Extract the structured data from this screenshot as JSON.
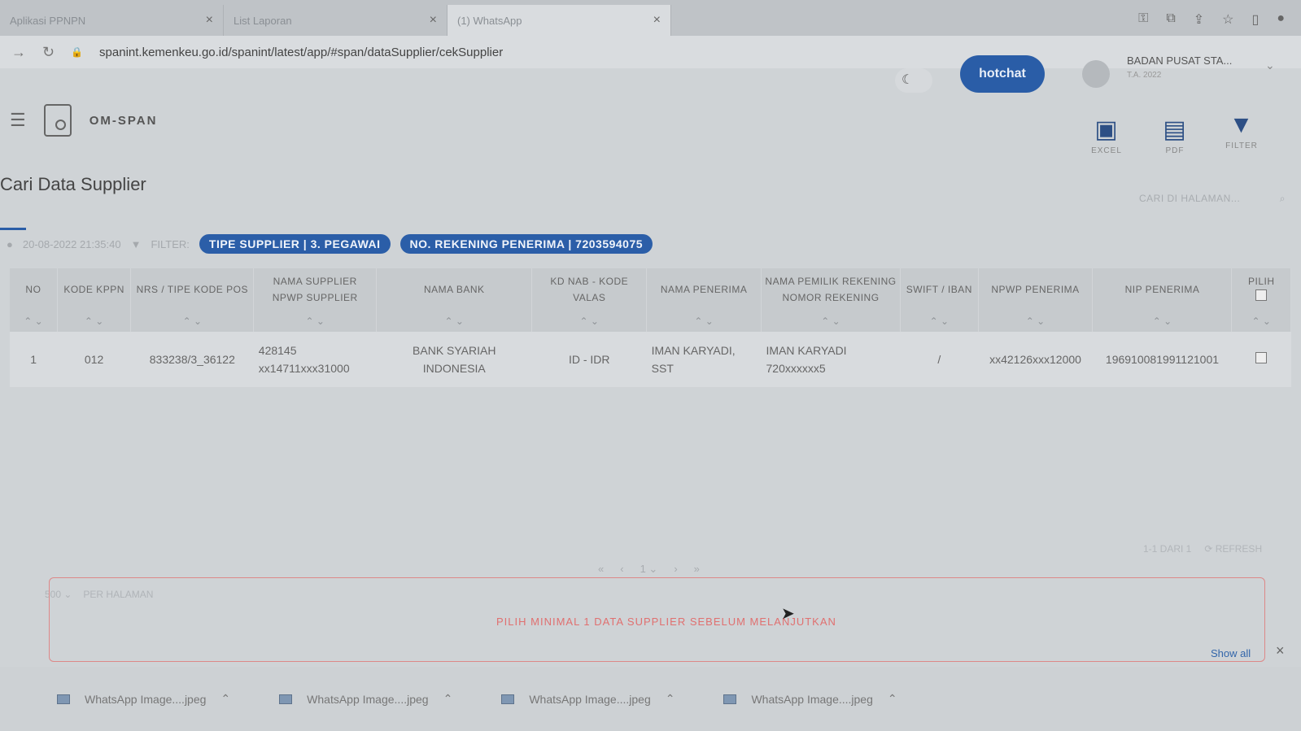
{
  "browser": {
    "tabs": [
      {
        "title": "Aplikasi PPNPN",
        "active": false
      },
      {
        "title": "List Laporan",
        "active": false
      },
      {
        "title": "(1) WhatsApp",
        "active": true
      }
    ],
    "url": "spanint.kemenkeu.go.id/spanint/latest/app/#span/dataSupplier/cekSupplier"
  },
  "header": {
    "hotchat_label": "hotchat",
    "user_name": "BADAN PUSAT STA...",
    "user_sub": "T.A. 2022",
    "app_name": "OM-SPAN",
    "tools": [
      {
        "label": "EXCEL",
        "icon": "excel-icon"
      },
      {
        "label": "PDF",
        "icon": "pdf-icon"
      },
      {
        "label": "FILTER",
        "icon": "filter-icon"
      }
    ]
  },
  "page": {
    "title": "Cari Data Supplier",
    "search_placeholder": "CARI DI HALAMAN...",
    "timestamp": "20-08-2022 21:35:40",
    "filter_label": "FILTER:",
    "chips": [
      "TIPE SUPPLIER | 3. PEGAWAI",
      "NO. REKENING PENERIMA | 7203594075"
    ]
  },
  "table": {
    "headers": {
      "no": "NO",
      "kppn": "KODE KPPN",
      "nrs": "NRS / TIPE KODE POS",
      "supplier": "NAMA SUPPLIER NPWP SUPPLIER",
      "bank": "NAMA BANK",
      "valas": "KD NAB - KODE VALAS",
      "penerima": "NAMA PENERIMA",
      "pemilik": "NAMA PEMILIK REKENING NOMOR REKENING",
      "swift": "SWIFT / IBAN",
      "npwp": "NPWP PENERIMA",
      "nip": "NIP PENERIMA",
      "pilih": "PILIH"
    },
    "rows": [
      {
        "no": "1",
        "kppn": "012",
        "nrs": "833238/3_36122",
        "supplier_name": "428145",
        "supplier_npwp": "xx14711xxx31000",
        "bank": "BANK SYARIAH INDONESIA",
        "valas": "ID - IDR",
        "penerima": "IMAN KARYADI, SST",
        "pemilik_name": "IMAN KARYADI",
        "pemilik_rek": "720xxxxxx5",
        "swift": "/",
        "npwp": "xx42126xxx12000",
        "nip": "196910081991121001"
      }
    ]
  },
  "pagination": {
    "info": "1-1 DARI 1",
    "refresh": "REFRESH",
    "current_page": "1",
    "per_page_value": "500",
    "per_page_label": "PER HALAMAN"
  },
  "alert": {
    "text": "PILIH MINIMAL 1 DATA SUPPLIER SEBELUM MELANJUTKAN"
  },
  "downloads": {
    "items": [
      "WhatsApp Image....jpeg",
      "WhatsApp Image....jpeg",
      "WhatsApp Image....jpeg",
      "WhatsApp Image....jpeg"
    ],
    "show_all": "Show all"
  }
}
